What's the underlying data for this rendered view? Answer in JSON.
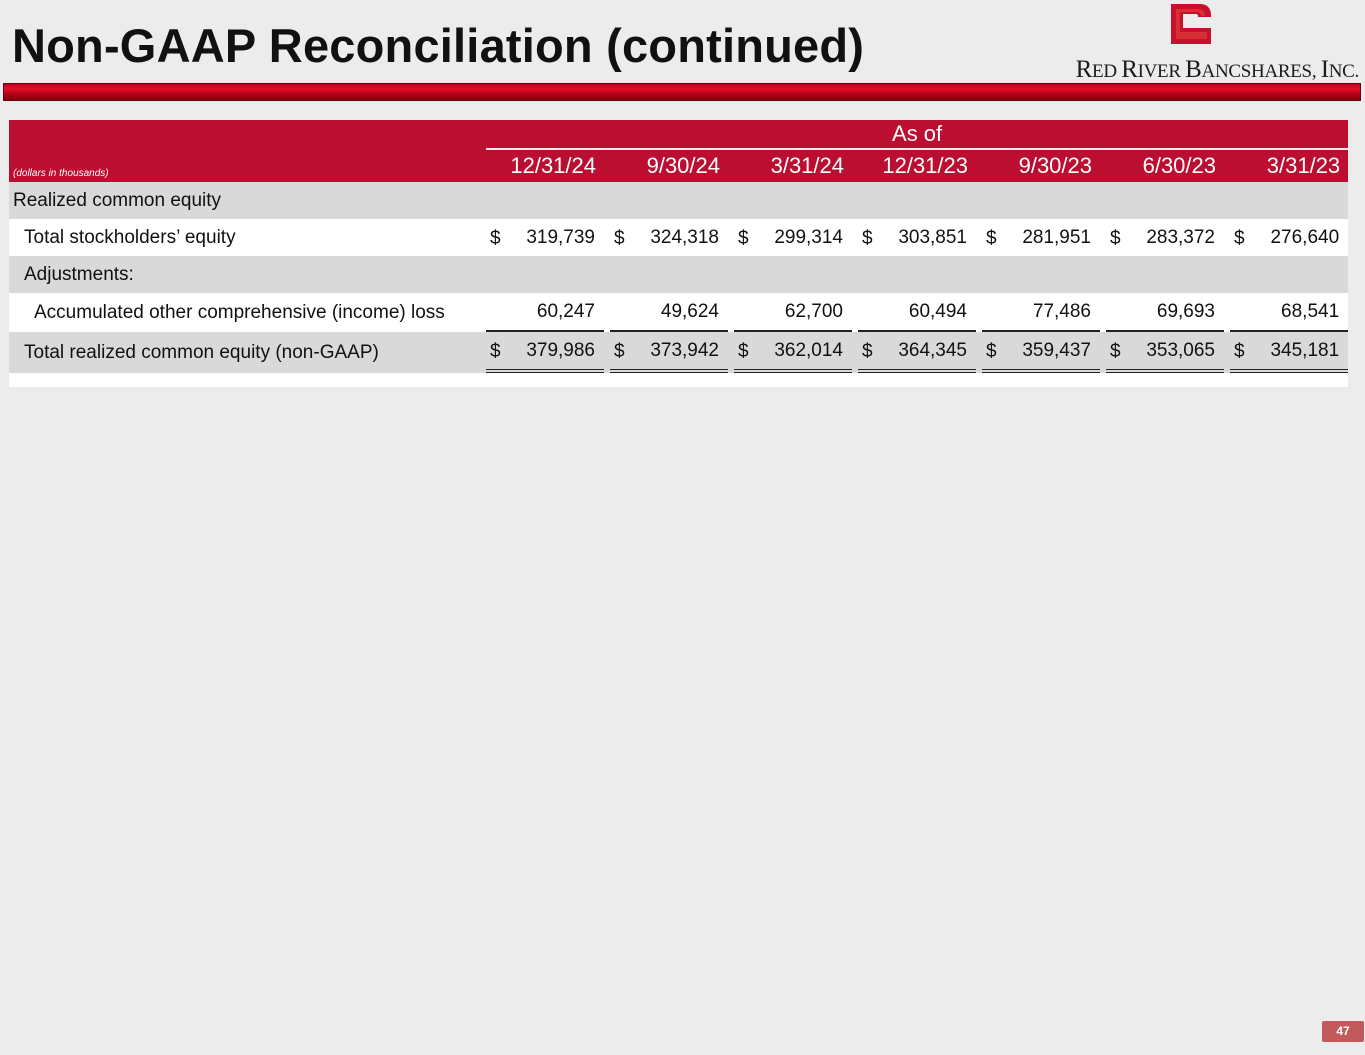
{
  "page": {
    "title": "Non-GAAP Reconciliation (continued)",
    "page_number": "47"
  },
  "logo": {
    "name_r": "R",
    "name_1": "ED ",
    "name_r2": "R",
    "name_2": "IVER ",
    "name_b": "B",
    "name_3": "ANCSHARES, ",
    "name_i": "I",
    "name_4": "NC.",
    "icon": "river-mark-icon",
    "brand_color": "#c8102e"
  },
  "table": {
    "units_note": "(dollars in thousands)",
    "group_header": "As of",
    "columns": [
      "12/31/24",
      "9/30/24",
      "3/31/24",
      "12/31/23",
      "9/30/23",
      "6/30/23",
      "3/31/23"
    ],
    "sections": {
      "realized_header": "Realized common equity",
      "total_equity_label": "Total stockholders’ equity",
      "total_equity_values": [
        "319,739",
        "324,318",
        "299,314",
        "303,851",
        "281,951",
        "283,372",
        "276,640"
      ],
      "adjustments_label": "Adjustments:",
      "aoci_label": "Accumulated other comprehensive (income) loss",
      "aoci_values": [
        "60,247",
        "49,624",
        "62,700",
        "60,494",
        "77,486",
        "69,693",
        "68,541"
      ],
      "total_realized_label": "Total realized common equity (non-GAAP)",
      "total_realized_values": [
        "379,986",
        "373,942",
        "362,014",
        "364,345",
        "359,437",
        "353,065",
        "345,181"
      ],
      "currency_symbol": "$"
    },
    "header_color": "#bb0e30"
  }
}
